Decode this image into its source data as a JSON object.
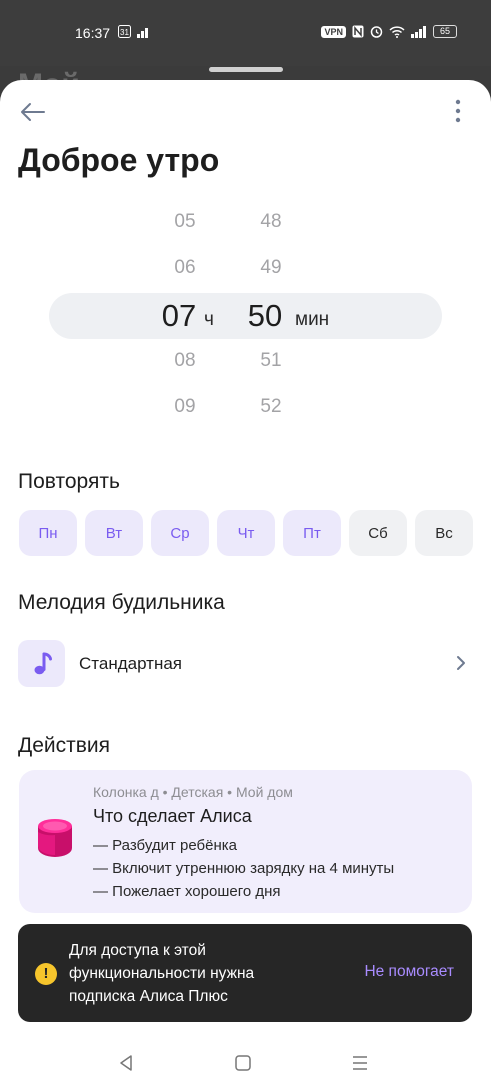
{
  "status_bar": {
    "time": "16:37",
    "left_icons": [
      "calendar-31-icon",
      "signal-icon"
    ],
    "right_icons": [
      "vpn-icon",
      "nfc-icon",
      "alarm-icon",
      "wifi-icon",
      "signal-icon",
      "battery-icon"
    ],
    "vpn": "VPN",
    "battery": "65"
  },
  "background": {
    "title_fragment": "Мой"
  },
  "header": {
    "title": "Доброе утро"
  },
  "time_picker": {
    "hours": [
      "05",
      "06",
      "07",
      "08",
      "09"
    ],
    "minutes": [
      "48",
      "49",
      "50",
      "51",
      "52"
    ],
    "hour_unit": "ч",
    "minute_unit": "мин",
    "selected_hour": "07",
    "selected_minute": "50"
  },
  "repeat": {
    "title": "Повторять",
    "days": [
      {
        "label": "Пн",
        "active": true
      },
      {
        "label": "Вт",
        "active": true
      },
      {
        "label": "Ср",
        "active": true
      },
      {
        "label": "Чт",
        "active": true
      },
      {
        "label": "Пт",
        "active": true
      },
      {
        "label": "Сб",
        "active": false
      },
      {
        "label": "Вс",
        "active": false
      }
    ]
  },
  "melody": {
    "title": "Мелодия будильника",
    "value": "Стандартная"
  },
  "actions": {
    "title": "Действия",
    "meta": "Колонка д • Детская • Мой дом",
    "card_title": "Что сделает Алиса",
    "items": [
      "— Разбудит ребёнка",
      "— Включит утреннюю зарядку на 4 минуты",
      "— Пожелает хорошего дня"
    ]
  },
  "toast": {
    "text": "Для доступа к этой функциональности нужна подписка Алиса Плюс",
    "action": "Не помогает",
    "icon": "!"
  },
  "colors": {
    "accent": "#7a5cf0",
    "accent_bg": "#ece9fb",
    "card_bg": "#f1eefc",
    "toast_bg": "#262626",
    "warning": "#f6c52c"
  }
}
